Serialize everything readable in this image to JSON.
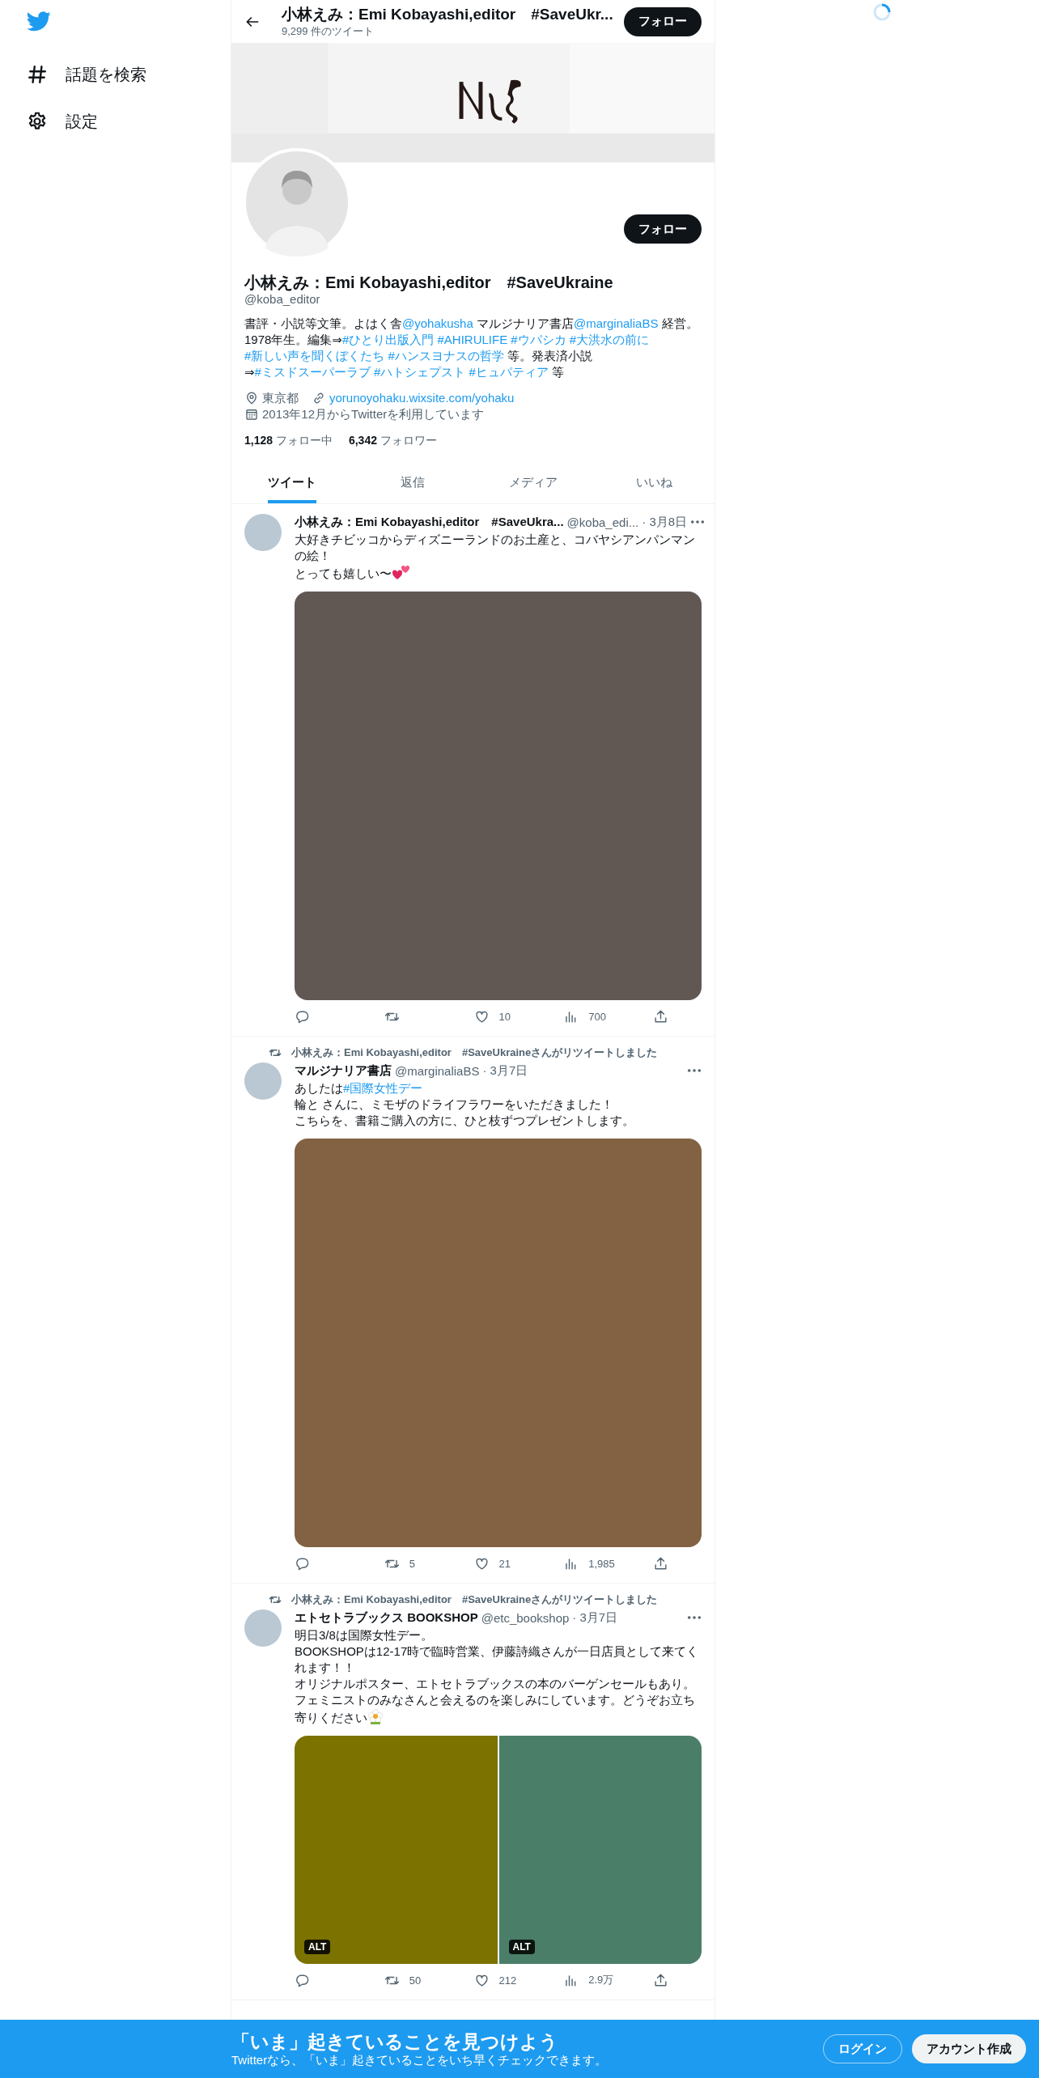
{
  "sidebar": {
    "items": [
      {
        "kind": "explore",
        "label": "話題を検索"
      },
      {
        "kind": "settings",
        "label": "設定"
      }
    ]
  },
  "header": {
    "title": "小林えみ：Emi Kobayashi,editor　#SaveUkr...",
    "tweet_count": "9,299 件のツイート",
    "follow_button": "フォロー"
  },
  "profile": {
    "follow_button": "フォロー",
    "name": "小林えみ：Emi Kobayashi,editor　#SaveUkraine",
    "handle": "@koba_editor",
    "bio": [
      {
        "kind": "text",
        "text": "書評・小説等文筆。よはく舎"
      },
      {
        "kind": "link",
        "text": "@yohakusha"
      },
      {
        "kind": "text",
        "text": "マルジナリア書店"
      },
      {
        "kind": "link",
        "text": "@marginaliaBS"
      },
      {
        "kind": "text",
        "text": "経営。1978年生。編集⇒"
      },
      {
        "kind": "link",
        "text": "#ひとり出版入門"
      },
      {
        "kind": "link",
        "text": "#AHIRULIFE"
      },
      {
        "kind": "link",
        "text": "#ウパシカ"
      },
      {
        "kind": "link",
        "text": "#大洪水の前に"
      },
      {
        "kind": "link",
        "text": "#新しい声を聞くぼくたち"
      },
      {
        "kind": "link",
        "text": "#ハンスヨナスの哲学"
      },
      {
        "kind": "text",
        "text": "等。発表済小説⇒"
      },
      {
        "kind": "link",
        "text": "#ミスドスーパーラブ"
      },
      {
        "kind": "link",
        "text": "#ハトシェプスト"
      },
      {
        "kind": "link",
        "text": "#ヒュパティア"
      },
      {
        "kind": "text",
        "text": "等"
      }
    ],
    "location": "東京都",
    "website": "yorunoyohaku.wixsite.com/yohaku",
    "joined": "2013年12月からTwitterを利用しています",
    "following_count": "1,128",
    "following_label": "フォロー中",
    "followers_count": "6,342",
    "followers_label": "フォロワー"
  },
  "tabs": [
    {
      "label": "ツイート",
      "selected": true
    },
    {
      "label": "返信",
      "selected": false
    },
    {
      "label": "メディア",
      "selected": false
    },
    {
      "label": "いいね",
      "selected": false
    }
  ],
  "tweets": [
    {
      "name": "小林えみ：Emi Kobayashi,editor　#SaveUkra...",
      "handle": "@koba_edi...",
      "date": "· 3月8日",
      "paragraphs": [
        [
          {
            "kind": "text",
            "text": "大好きチビッコからディズニーランドのお土産と、コバヤシアンパンマンの絵！"
          }
        ],
        [
          {
            "kind": "text",
            "text": "とっても嬉しい〜"
          },
          {
            "kind": "heart"
          }
        ]
      ],
      "media": [
        {
          "color": "#625853"
        }
      ],
      "actions": [
        {
          "kind": "reply"
        },
        {
          "kind": "retweet"
        },
        {
          "kind": "like",
          "count": "10"
        },
        {
          "kind": "views",
          "count": "700"
        },
        {
          "kind": "share"
        }
      ]
    },
    {
      "retweeted_by": "小林えみ：Emi Kobayashi,editor　#SaveUkraineさんがリツイートしました",
      "name": "マルジナリア書店",
      "handle": "@marginaliaBS",
      "date": "· 3月7日",
      "paragraphs": [
        [
          {
            "kind": "text",
            "text": "あしたは"
          },
          {
            "kind": "link",
            "text": "#国際女性デー"
          }
        ],
        [
          {
            "kind": "text",
            "text": "輪と さんに、ミモザのドライフラワーをいただきました！"
          }
        ],
        [
          {
            "kind": "text",
            "text": "こちらを、書籍ご購入の方に、ひと枝ずつプレゼントします。"
          }
        ]
      ],
      "media": [
        {
          "color": "#826243"
        }
      ],
      "actions": [
        {
          "kind": "reply"
        },
        {
          "kind": "retweet",
          "count": "5"
        },
        {
          "kind": "like",
          "count": "21"
        },
        {
          "kind": "views",
          "count": "1,985"
        },
        {
          "kind": "share"
        }
      ]
    },
    {
      "retweeted_by": "小林えみ：Emi Kobayashi,editor　#SaveUkraineさんがリツイートしました",
      "name": "エトセトラブックス BOOKSHOP",
      "handle": "@etc_bookshop",
      "date": "· 3月7日",
      "paragraphs": [
        [
          {
            "kind": "text",
            "text": "明日3/8は国際女性デー。"
          }
        ],
        [
          {
            "kind": "text",
            "text": "BOOKSHOPは12-17時で臨時営業、伊藤詩織さんが一日店員として来てくれます！！"
          }
        ],
        [
          {
            "kind": "text",
            "text": "オリジナルポスター、エトセトラブックスの本のバーゲンセールもあり。"
          }
        ],
        [
          {
            "kind": "text",
            "text": "フェミニストのみなさんと会えるのを楽しみにしています。どうぞお立ち寄りください"
          },
          {
            "kind": "flower"
          }
        ]
      ],
      "media": [
        {
          "color": "#7b7200",
          "badge": "ALT"
        },
        {
          "color": "#4a7e68",
          "badge": "ALT"
        }
      ],
      "actions": [
        {
          "kind": "reply"
        },
        {
          "kind": "retweet",
          "count": "50"
        },
        {
          "kind": "like",
          "count": "212"
        },
        {
          "kind": "views",
          "count": "2.9万"
        },
        {
          "kind": "share"
        }
      ]
    }
  ],
  "signup_banner": {
    "title": "「いま」起きていることを見つけよう",
    "subtitle": "Twitterなら、「いま」起きていることをいち早くチェックできます。",
    "login_button": "ログイン",
    "signup_button": "アカウント作成"
  }
}
